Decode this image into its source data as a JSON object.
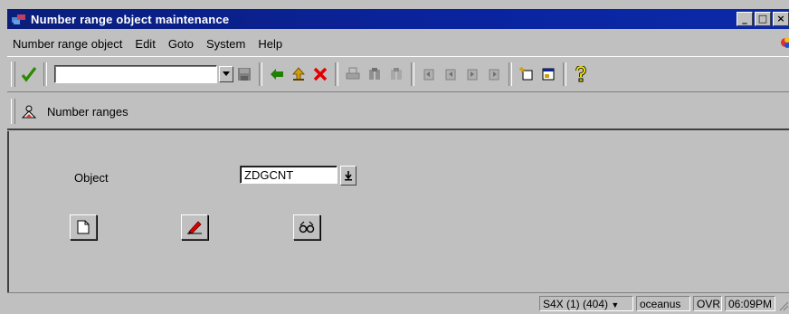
{
  "window": {
    "title": "Number range object maintenance",
    "buttons": [
      "_",
      "□",
      "×"
    ]
  },
  "menubar": {
    "items": [
      "Number range object",
      "Edit",
      "Goto",
      "System",
      "Help"
    ]
  },
  "toolbar": {
    "icons": [
      "check-icon",
      "save-icon",
      "back-icon",
      "exit-icon",
      "cancel-icon",
      "print-icon",
      "find-icon",
      "find-next-icon",
      "first-page-icon",
      "previous-page-icon",
      "next-page-icon",
      "last-page-icon",
      "create-session-icon",
      "create-shortcut-icon",
      "help-icon"
    ],
    "command_value": ""
  },
  "app_toolbar": {
    "label": "Number ranges"
  },
  "form": {
    "object_label": "Object",
    "object_value": "ZDGCNT"
  },
  "statusbar": {
    "system": "S4X (1) (404)",
    "host": "oceanus",
    "mode": "OVR",
    "time": "06:09PM"
  },
  "colors": {
    "title_bg": "#0a24a0",
    "window_bg": "#c0c0c0",
    "check_green": "#2a8a00",
    "cancel_red": "#e00000"
  }
}
